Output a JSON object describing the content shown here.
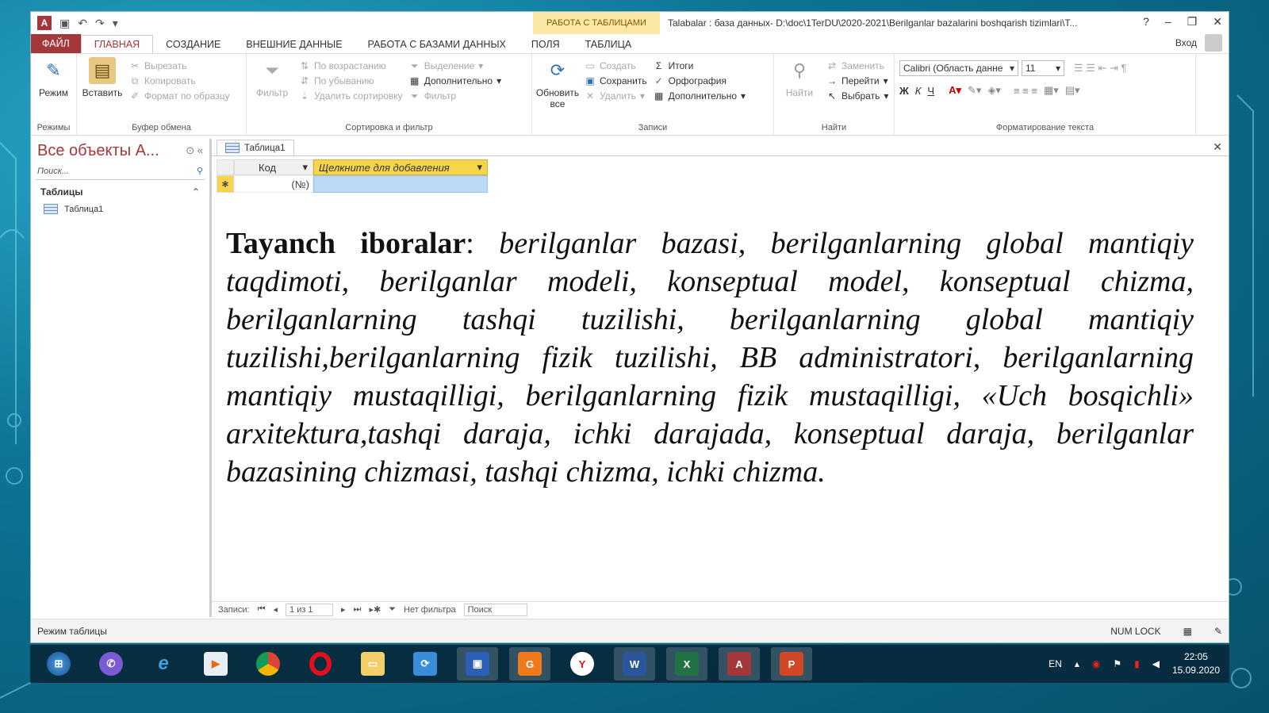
{
  "window": {
    "context_tab_header": "РАБОТА С ТАБЛИЦАМИ",
    "title": "Talabalar : база данных- D:\\doc\\1TerDU\\2020-2021\\Berilganlar bazalarini boshqarish tizimlari\\T...",
    "help": "?",
    "minimize": "–",
    "restore": "❐",
    "close": "✕"
  },
  "tabs": [
    "ФАЙЛ",
    "ГЛАВНАЯ",
    "СОЗДАНИЕ",
    "ВНЕШНИЕ ДАННЫЕ",
    "РАБОТА С БАЗАМИ ДАННЫХ",
    "ПОЛЯ",
    "ТАБЛИЦА"
  ],
  "login": "Вход",
  "ribbon": {
    "modes": {
      "button": "Режим",
      "label": "Режимы"
    },
    "clipboard": {
      "paste": "Вставить",
      "cut": "Вырезать",
      "copy": "Копировать",
      "format_painter": "Формат по образцу",
      "label": "Буфер обмена"
    },
    "sort_filter": {
      "filter": "Фильтр",
      "ascending": "По возрастанию",
      "descending": "По убыванию",
      "remove_sort": "Удалить сортировку",
      "selection": "Выделение",
      "advanced": "Дополнительно",
      "toggle_filter": "Фильтр",
      "label": "Сортировка и фильтр"
    },
    "records": {
      "refresh": "Обновить все",
      "new": "Создать",
      "save": "Сохранить",
      "delete": "Удалить",
      "totals": "Итоги",
      "spelling": "Орфография",
      "more": "Дополнительно",
      "label": "Записи"
    },
    "find": {
      "find": "Найти",
      "replace": "Заменить",
      "goto": "Перейти",
      "select": "Выбрать",
      "label": "Найти"
    },
    "text_format": {
      "font": "Calibri (Область данне",
      "size": "11",
      "bold": "Ж",
      "italic": "К",
      "underline": "Ч",
      "label": "Форматирование текста"
    }
  },
  "nav_pane": {
    "title": "Все объекты A...",
    "search_placeholder": "Поиск...",
    "category": "Таблицы",
    "items": [
      "Таблица1"
    ]
  },
  "document": {
    "tab": "Таблица1",
    "col_kod": "Код",
    "col_add": "Щелкните для добавления",
    "new_row_marker": "✱",
    "new_row_value": "(№)"
  },
  "keywords": {
    "heading": "Tayanch iboralar",
    "separator": ": ",
    "text": "berilganlar bazasi, berilganlarning global mantiqiy taqdimoti, berilganlar modeli, konseptual model, konseptual chizma, berilganlarning tashqi tuzilishi, berilganlarning global mantiqiy tuzilishi,berilganlarning fizik tuzilishi, BB administratori, berilganlarning mantiqiy mustaqilligi, berilganlarning fizik mustaqilligi, «Uch bosqichli» arxitektura,tashqi daraja, ichki darajada, konseptual daraja, berilganlar bazasining chizmasi, tashqi chizma, ichki chizma."
  },
  "record_nav": {
    "label": "Записи:",
    "position": "1 из 1",
    "no_filter": "Нет фильтра",
    "search": "Поиск"
  },
  "statusbar": {
    "mode": "Режим таблицы",
    "numlock": "NUM LOCK"
  },
  "taskbar": {
    "apps": [
      "start",
      "viber",
      "internet-explorer",
      "media-player",
      "chrome",
      "opera",
      "file-explorer",
      "network",
      "floppy-save",
      "avast",
      "yandex",
      "word",
      "excel",
      "access",
      "powerpoint"
    ],
    "lang": "EN",
    "time": "22:05",
    "date": "15.09.2020"
  },
  "colors": {
    "access_red": "#a4373a",
    "context_yellow": "#fbe8a6",
    "add_column_yellow": "#f7d54a"
  }
}
